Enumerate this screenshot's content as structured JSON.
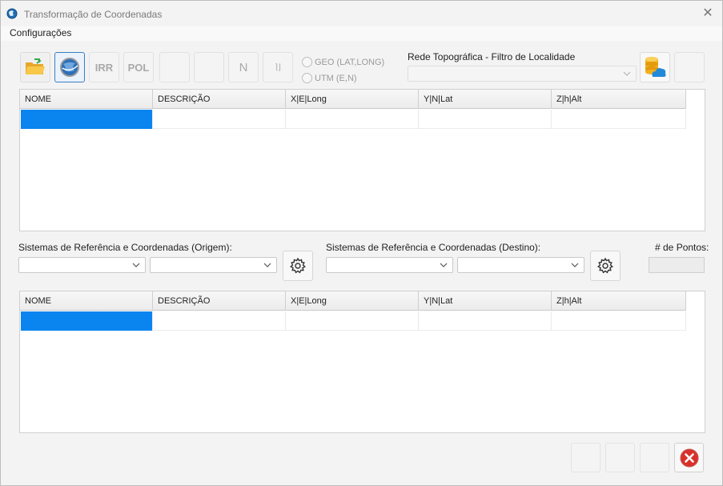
{
  "window": {
    "title": "Transformação de Coordenadas",
    "icon": "globe-app-icon",
    "close_icon": "close-icon"
  },
  "menu": {
    "items": [
      "Configurações"
    ]
  },
  "toolbar": {
    "buttons": [
      {
        "name": "open-folder",
        "label": "",
        "icon": "folder-open-icon"
      },
      {
        "name": "google-earth",
        "label": "",
        "icon": "globe-icon"
      },
      {
        "name": "irr",
        "label": "IRR",
        "icon": ""
      },
      {
        "name": "pol",
        "label": "POL",
        "icon": ""
      },
      {
        "name": "blank1",
        "label": "",
        "icon": ""
      },
      {
        "name": "blank2",
        "label": "",
        "icon": ""
      },
      {
        "name": "north",
        "label": "N",
        "icon": ""
      },
      {
        "name": "bracket",
        "label": "⌉⌋",
        "icon": ""
      }
    ],
    "radio_geo": "GEO (LAT,LONG)",
    "radio_utm": "UTM (E,N)",
    "rede_label": "Rede Topográfica - Filtro de Localidade",
    "rede_value": "",
    "db_cloud_icon": "database-cloud-icon"
  },
  "grid_top": {
    "headers": [
      "NOME",
      "DESCRIÇÃO",
      "X|E|Long",
      "Y|N|Lat",
      "Z|h|Alt"
    ],
    "rows": [
      [
        "",
        "",
        "",
        "",
        ""
      ]
    ]
  },
  "origem": {
    "label": "Sistemas de Referência e Coordenadas (Origem):",
    "combo1": "",
    "combo2": ""
  },
  "destino": {
    "label": "Sistemas de Referência e Coordenadas (Destino):",
    "combo1": "",
    "combo2": ""
  },
  "pontos": {
    "label": "# de Pontos:",
    "value": ""
  },
  "grid_bottom": {
    "headers": [
      "NOME",
      "DESCRIÇÃO",
      "X|E|Long",
      "Y|N|Lat",
      "Z|h|Alt"
    ],
    "rows": [
      [
        "",
        "",
        "",
        "",
        ""
      ]
    ]
  },
  "colors": {
    "selection": "#0a84ef",
    "exit_red": "#d9302b",
    "active_border": "#3b7fc4"
  }
}
